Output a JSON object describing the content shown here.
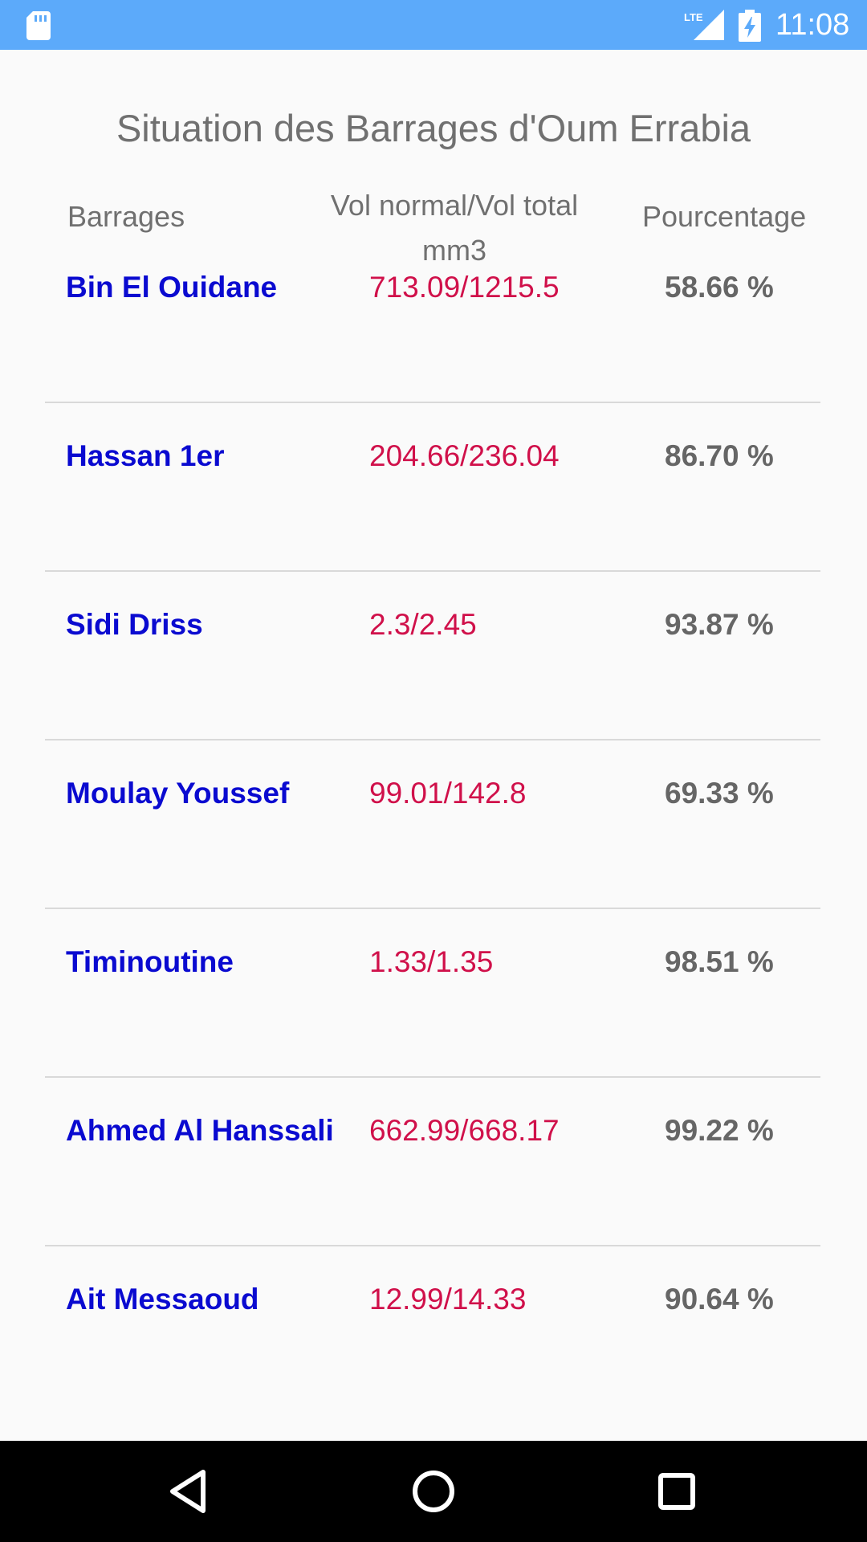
{
  "status_bar": {
    "time": "11:08",
    "network_label": "LTE",
    "sd_icon": "sd-card-icon",
    "battery_icon": "battery-charging-icon"
  },
  "title": "Situation des Barrages d'Oum Errabia",
  "headers": {
    "barrages": "Barrages",
    "volume_line1": "Vol normal/Vol total",
    "volume_line2": "mm3",
    "percentage": "Pourcentage"
  },
  "rows": [
    {
      "name": "Bin El Ouidane",
      "volume": "713.09/1215.5",
      "percentage": "58.66 %"
    },
    {
      "name": "Hassan 1er",
      "volume": "204.66/236.04",
      "percentage": "86.70 %"
    },
    {
      "name": "Sidi Driss",
      "volume": "2.3/2.45",
      "percentage": "93.87 %"
    },
    {
      "name": "Moulay Youssef",
      "volume": "99.01/142.8",
      "percentage": "69.33 %"
    },
    {
      "name": "Timinoutine",
      "volume": "1.33/1.35",
      "percentage": "98.51 %"
    },
    {
      "name": "Ahmed Al Hanssali",
      "volume": "662.99/668.17",
      "percentage": "99.22 %"
    },
    {
      "name": "Ait Messaoud",
      "volume": "12.99/14.33",
      "percentage": "90.64 %"
    }
  ],
  "nav_bar": {
    "back_icon": "back-triangle-icon",
    "home_icon": "home-circle-icon",
    "recent_icon": "recent-apps-square-icon"
  },
  "colors": {
    "status_bar": "#5caafa",
    "name": "#0a0ad0",
    "volume": "#d0104a",
    "percentage": "#666666",
    "header": "#707070"
  }
}
